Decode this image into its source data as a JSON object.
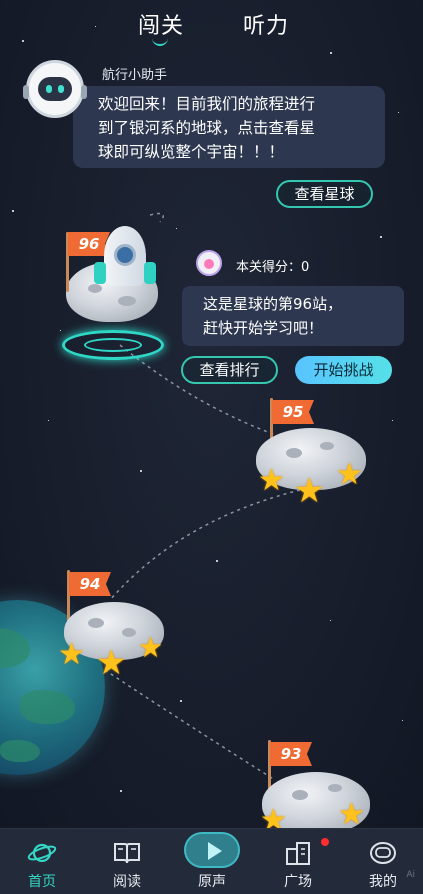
{
  "top_tabs": [
    {
      "label": "闯关",
      "active": true
    },
    {
      "label": "听力",
      "active": false
    }
  ],
  "assistant": {
    "name": "航行小助手",
    "message_line1": "欢迎回来！目前我们的旅程进行",
    "message_line2": "到了银河系的地球，点击查看星",
    "message_line3": "球即可纵览整个宇宙！！！",
    "view_planet_button": "查看星球"
  },
  "current_level": {
    "score_label": "本关得分：0",
    "message_line1": "这是星球的第96站，",
    "message_line2": "赶快开始学习吧！",
    "rank_button": "查看排行",
    "start_button": "开始挑战"
  },
  "stations": [
    {
      "number": "96",
      "stars": 0,
      "current": true
    },
    {
      "number": "95",
      "stars": 3,
      "current": false
    },
    {
      "number": "94",
      "stars": 3,
      "current": false
    },
    {
      "number": "93",
      "stars": 3,
      "current": false
    }
  ],
  "bottom_nav": [
    {
      "label": "首页",
      "icon": "planet-icon",
      "active": true
    },
    {
      "label": "阅读",
      "icon": "book-icon",
      "active": false
    },
    {
      "label": "原声",
      "icon": "play-icon",
      "active": false
    },
    {
      "label": "广场",
      "icon": "buildings-icon",
      "active": false,
      "badge": true
    },
    {
      "label": "我的",
      "icon": "astronaut-helmet-icon",
      "active": false
    }
  ],
  "colors": {
    "accent": "#35d6c6",
    "background": "#161c2a",
    "bubble": "#2d3850",
    "flag": "#f06a34",
    "star": "#ffc21c",
    "badge": "#ff2d2d"
  },
  "watermark": "Ai"
}
